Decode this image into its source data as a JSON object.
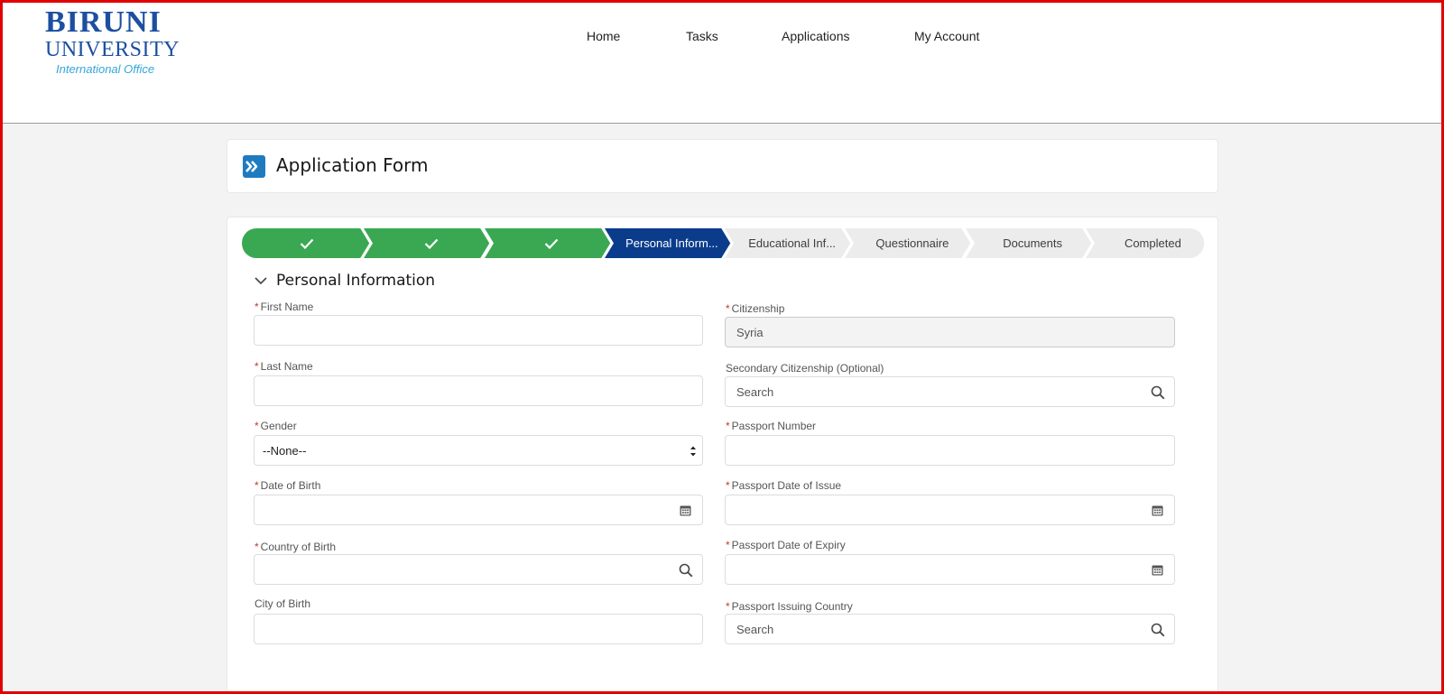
{
  "logo": {
    "line1": "BIRUNI",
    "line2": "UNIVERSITY",
    "line3": "International Office"
  },
  "nav": {
    "items": [
      "Home",
      "Tasks",
      "Applications",
      "My Account"
    ]
  },
  "page": {
    "title": "Application Form"
  },
  "path": {
    "steps": [
      {
        "label": "",
        "state": "complete"
      },
      {
        "label": "",
        "state": "complete"
      },
      {
        "label": "",
        "state": "complete"
      },
      {
        "label": "Personal Inform...",
        "state": "current"
      },
      {
        "label": "Educational Inf...",
        "state": "incomplete"
      },
      {
        "label": "Questionnaire",
        "state": "incomplete"
      },
      {
        "label": "Documents",
        "state": "incomplete"
      },
      {
        "label": "Completed",
        "state": "incomplete"
      }
    ],
    "colors": {
      "complete": "#3aa853",
      "current": "#0b3c8c",
      "incomplete": "#ececec"
    }
  },
  "section": {
    "title": "Personal Information"
  },
  "form": {
    "left": [
      {
        "label": "First Name",
        "required": true,
        "value": "",
        "placeholder": "",
        "icon": ""
      },
      {
        "label": "Last Name",
        "required": true,
        "value": "",
        "placeholder": "",
        "icon": ""
      },
      {
        "label": "Gender",
        "required": true,
        "value": "--None--",
        "placeholder": "",
        "icon": "select-arrows-icon"
      },
      {
        "label": "Date of Birth",
        "required": true,
        "value": "",
        "placeholder": "",
        "icon": "calendar-icon"
      },
      {
        "label": "Country of Birth",
        "required": true,
        "value": "",
        "placeholder": "",
        "icon": "search-icon"
      },
      {
        "label": "City of Birth",
        "required": false,
        "value": "",
        "placeholder": "",
        "icon": ""
      }
    ],
    "right": [
      {
        "label": "Citizenship",
        "required": true,
        "value": "Syria",
        "placeholder": "",
        "icon": "",
        "readonly": true
      },
      {
        "label": "Secondary Citizenship (Optional)",
        "required": false,
        "value": "",
        "placeholder": "Search",
        "icon": "search-icon"
      },
      {
        "label": "Passport Number",
        "required": true,
        "value": "",
        "placeholder": "",
        "icon": ""
      },
      {
        "label": "Passport Date of Issue",
        "required": true,
        "value": "",
        "placeholder": "",
        "icon": "calendar-icon"
      },
      {
        "label": "Passport Date of Expiry",
        "required": true,
        "value": "",
        "placeholder": "",
        "icon": "calendar-icon"
      },
      {
        "label": "Passport Issuing Country",
        "required": true,
        "value": "",
        "placeholder": "Search",
        "icon": "search-icon"
      }
    ]
  }
}
